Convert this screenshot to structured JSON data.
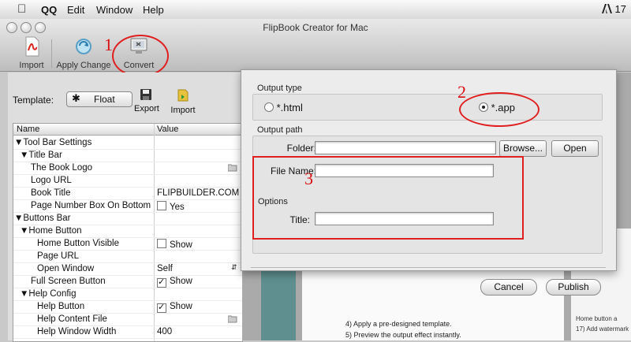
{
  "menubar": {
    "apple_icon": "apple-logo",
    "app_name": "QQ",
    "items": [
      "Edit",
      "Window",
      "Help"
    ],
    "right_text": "17",
    "right_icon": "adobe-icon"
  },
  "window": {
    "title": "FlipBook Creator for Mac"
  },
  "toolbar": {
    "import_label": "Import",
    "apply_label": "Apply Change",
    "convert_label": "Convert"
  },
  "annotations": {
    "step1": "1",
    "step2": "2",
    "step3": "3",
    "color": "#e02020"
  },
  "template": {
    "label": "Template:",
    "value": "Float",
    "export_label": "Export",
    "import_label": "Import"
  },
  "grid": {
    "headers": [
      "Name",
      "Value"
    ],
    "rows": [
      {
        "name": "Tool Bar Settings",
        "value": ""
      },
      {
        "name": "Title Bar",
        "value": ""
      },
      {
        "name": "The Book Logo",
        "value": ""
      },
      {
        "name": "Logo URL",
        "value": ""
      },
      {
        "name": "Book Title",
        "value": "FLIPBUILDER.COM"
      },
      {
        "name": "Page Number Box On Bottom",
        "value": "Yes"
      },
      {
        "name": "Buttons Bar",
        "value": ""
      },
      {
        "name": "Home Button",
        "value": ""
      },
      {
        "name": "Home Button Visible",
        "value": "Show"
      },
      {
        "name": "Page URL",
        "value": ""
      },
      {
        "name": "Open Window",
        "value": "Self"
      },
      {
        "name": "Full Screen Button",
        "value": "Show"
      },
      {
        "name": "Help Config",
        "value": ""
      },
      {
        "name": "Help Button",
        "value": "Show"
      },
      {
        "name": "Help Content File",
        "value": ""
      },
      {
        "name": "Help Window Width",
        "value": "400"
      }
    ]
  },
  "dialog": {
    "output_type_title": "Output type",
    "option_html": "*.html",
    "option_app": "*.app",
    "selected": "*.app",
    "output_path_title": "Output path",
    "folder_label": "Folder:",
    "folder_value": "",
    "browse_label": "Browse...",
    "open_label": "Open",
    "filename_label": "File Name:",
    "filename_value": "",
    "options_title": "Options",
    "title_label": "Title:",
    "title_value": "",
    "cancel_label": "Cancel",
    "publish_label": "Publish"
  },
  "background_doc": {
    "lines": [
      "4)   Apply a pre-designed template.",
      "5)   Preview the output effect instantly."
    ],
    "right_lines": [
      "Home button a",
      "17) Add watermark"
    ]
  }
}
